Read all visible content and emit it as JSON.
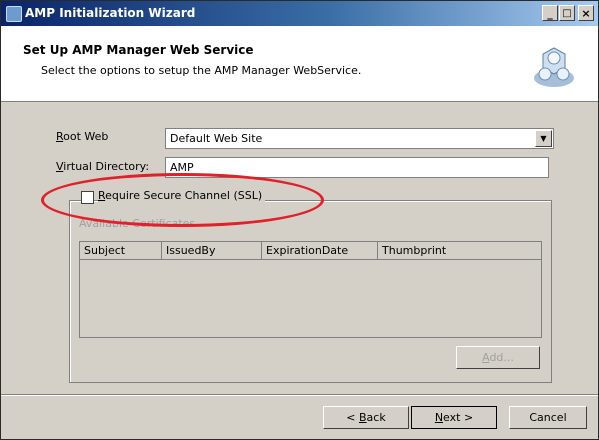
{
  "window": {
    "title": "AMP Initialization Wizard",
    "controls": {
      "minimize": "_",
      "maximize": "□",
      "close": "×"
    }
  },
  "header": {
    "title": "Set Up AMP Manager Web Service",
    "subtitle": "Select the options to setup the AMP Manager WebService.",
    "icon": "network-icon"
  },
  "form": {
    "root_web": {
      "label_prefix": "R",
      "label_rest": "oot Web",
      "value": "Default Web Site"
    },
    "virtual_directory": {
      "label_prefix": "V",
      "label_rest": "irtual Directory:",
      "value": "AMP"
    },
    "ssl": {
      "label_prefix": "R",
      "label_rest": "equire Secure Channel (SSL)",
      "checked": false
    },
    "available_certificates_label": "Available Certificates",
    "columns": [
      "Subject",
      "IssuedBy",
      "ExpirationDate",
      "Thumbprint"
    ],
    "add_button": {
      "prefix": "A",
      "rest": "dd..."
    }
  },
  "footer": {
    "back": {
      "text": "< ",
      "hot": "B",
      "rest": "ack"
    },
    "next": {
      "hot": "N",
      "rest": "ext >"
    },
    "cancel": "Cancel"
  },
  "colors": {
    "title_start": "#0a246a",
    "title_end": "#a6caf0",
    "dialog_bg": "#d4d0c8",
    "annotation": "#e0202a"
  }
}
